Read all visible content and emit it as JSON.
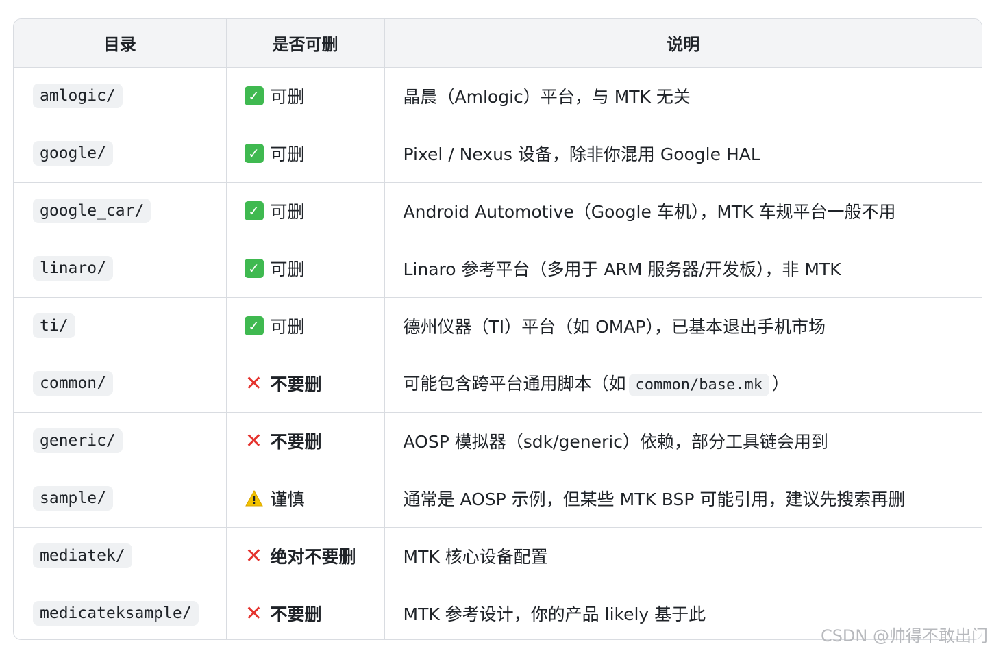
{
  "header": {
    "col_dir": "目录",
    "col_deletable": "是否可删",
    "col_desc": "说明"
  },
  "rows": [
    {
      "dir": "amlogic/",
      "status": "可删",
      "kind": "ok",
      "desc": "晶晨（Amlogic）平台，与 MTK 无关"
    },
    {
      "dir": "google/",
      "status": "可删",
      "kind": "ok",
      "desc": "Pixel / Nexus 设备，除非你混用 Google HAL"
    },
    {
      "dir": "google_car/",
      "status": "可删",
      "kind": "ok",
      "desc": "Android Automotive（Google 车机），MTK 车规平台一般不用"
    },
    {
      "dir": "linaro/",
      "status": "可删",
      "kind": "ok",
      "desc": "Linaro 参考平台（多用于 ARM 服务器/开发板），非 MTK"
    },
    {
      "dir": "ti/",
      "status": "可删",
      "kind": "ok",
      "desc": "德州仪器（TI）平台（如 OMAP），已基本退出手机市场"
    },
    {
      "dir": "common/",
      "status": "不要删",
      "kind": "no",
      "desc_pre": "可能包含跨平台通用脚本（如",
      "desc_code": "common/base.mk",
      "desc_post": "）"
    },
    {
      "dir": "generic/",
      "status": "不要删",
      "kind": "no",
      "desc": "AOSP 模拟器（sdk/generic）依赖，部分工具链会用到"
    },
    {
      "dir": "sample/",
      "status": "谨慎",
      "kind": "warn",
      "desc": "通常是 AOSP 示例，但某些 MTK BSP 可能引用，建议先搜索再删"
    },
    {
      "dir": "mediatek/",
      "status": "绝对不要删",
      "kind": "no",
      "desc": "MTK 核心设备配置"
    },
    {
      "dir": "medicateksample/",
      "status": "不要删",
      "kind": "no",
      "desc": "MTK 参考设计，你的产品 likely 基于此"
    }
  ],
  "icons": {
    "ok": "check-mark-icon",
    "no": "cross-mark-icon",
    "warn": "warning-icon"
  },
  "colors": {
    "ok": "#3fb950",
    "no": "#e5322d",
    "warn": "#f2c200"
  },
  "watermark": "CSDN @帅得不敢出门"
}
